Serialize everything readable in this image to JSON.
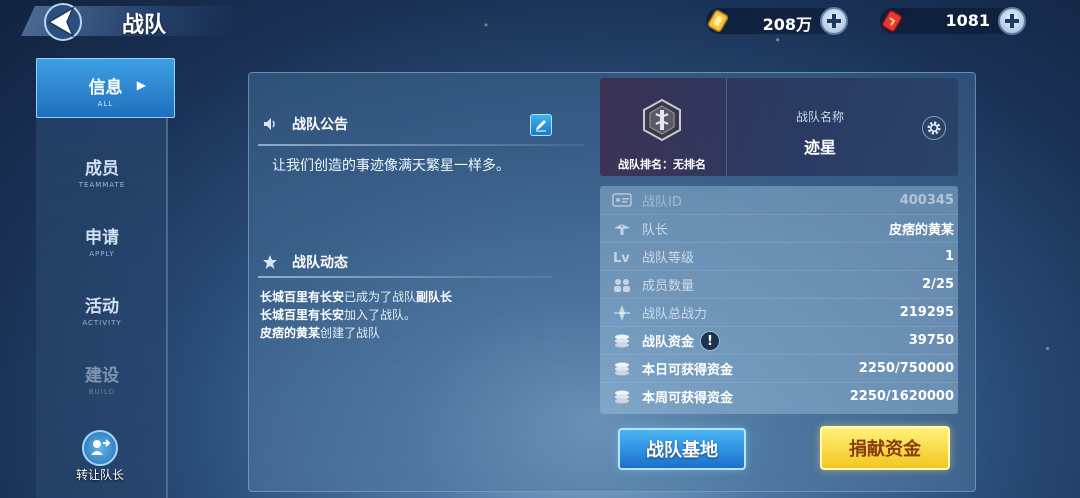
{
  "header": {
    "title": "战队",
    "gold": "208万",
    "gems": "1081"
  },
  "sidebar": {
    "items": [
      {
        "label": "信息",
        "sub": "ALL",
        "active": true
      },
      {
        "label": "成员",
        "sub": "TEAMMATE"
      },
      {
        "label": "申请",
        "sub": "APPLY"
      },
      {
        "label": "活动",
        "sub": "ACTIVITY"
      },
      {
        "label": "建设",
        "sub": "BUILD",
        "disabled": true
      }
    ],
    "transfer_label": "转让队长"
  },
  "announcement": {
    "title": "战队公告",
    "text": "让我们创造的事迹像满天繁星一样多。"
  },
  "activity": {
    "title": "战队动态",
    "lines": [
      {
        "who": "长城百里有长安",
        "what": "已成为了战队",
        "role": "副队长"
      },
      {
        "who": "长城百里有长安",
        "what": "加入了战队。"
      },
      {
        "who": "皮痞的黄某",
        "what": "创建了战队"
      }
    ]
  },
  "team_card": {
    "rank_text": "战队排名：无排名",
    "name_label": "战队名称",
    "name_value": "迹星"
  },
  "stats": [
    {
      "label": "战队ID",
      "value": "400345",
      "icon": "id-card-icon"
    },
    {
      "label": "队长",
      "value": "皮痞的黄某",
      "icon": "wings-icon"
    },
    {
      "label": "战队等级",
      "value": "1",
      "icon": "lv-icon"
    },
    {
      "label": "成员数量",
      "value": "2/25",
      "icon": "members-icon"
    },
    {
      "label": "战队总战力",
      "value": "219295",
      "icon": "power-icon"
    },
    {
      "label": "战队资金",
      "value": "39750",
      "icon": "coins-icon"
    },
    {
      "label": "本日可获得资金",
      "value": "2250/750000",
      "icon": "coins-icon"
    },
    {
      "label": "本周可获得资金",
      "value": "2250/1620000",
      "icon": "coins-icon"
    }
  ],
  "buttons": {
    "base": "战队基地",
    "donate": "捐献资金"
  }
}
